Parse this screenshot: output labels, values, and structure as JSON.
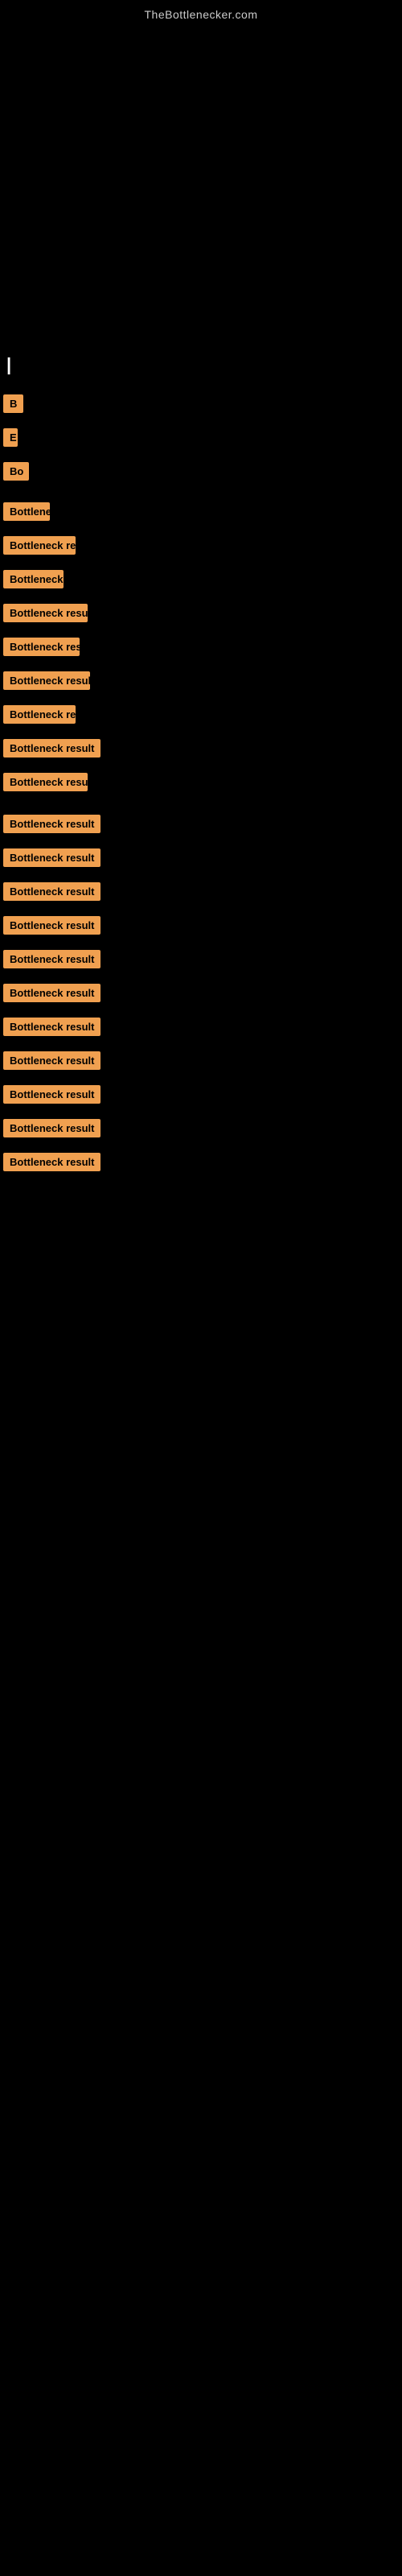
{
  "site": {
    "title": "TheBottlenecker.com"
  },
  "labels": [
    {
      "id": "lbl-pipe",
      "text": "|",
      "width_class": ""
    },
    {
      "id": "lbl-b1",
      "text": "B",
      "width_class": "w-short1"
    },
    {
      "id": "lbl-e1",
      "text": "E",
      "width_class": "w-short2"
    },
    {
      "id": "lbl-b2",
      "text": "Bo",
      "width_class": "w-short3"
    },
    {
      "id": "lbl-bottl1",
      "text": "Bottleneck result",
      "width_class": "w-med1"
    },
    {
      "id": "lbl-bottl2",
      "text": "Bottleneck result",
      "width_class": "w-med2"
    },
    {
      "id": "lbl-bottl3",
      "text": "Bottleneck result",
      "width_class": "w-med3"
    },
    {
      "id": "lbl-bottl4",
      "text": "Bottleneck result",
      "width_class": "w-med4"
    },
    {
      "id": "lbl-bottl5",
      "text": "Bottleneck result",
      "width_class": "w-med5"
    },
    {
      "id": "lbl-bottl6",
      "text": "Bottleneck result",
      "width_class": "w-med6"
    },
    {
      "id": "lbl-bottl7",
      "text": "Bottleneck result",
      "width_class": "w-med2"
    },
    {
      "id": "lbl-bottl8",
      "text": "Bottleneck result",
      "width_class": "w-full"
    },
    {
      "id": "lbl-bottl9",
      "text": "Bottleneck result",
      "width_class": "w-med4"
    },
    {
      "id": "lbl-bottl10",
      "text": "Bottleneck result",
      "width_class": "w-full2"
    },
    {
      "id": "lbl-bottl11",
      "text": "Bottleneck result",
      "width_class": "w-full2"
    },
    {
      "id": "lbl-bottl12",
      "text": "Bottleneck result",
      "width_class": "w-full2"
    },
    {
      "id": "lbl-bottl13",
      "text": "Bottleneck result",
      "width_class": "w-full2"
    },
    {
      "id": "lbl-bottl14",
      "text": "Bottleneck result",
      "width_class": "w-full2"
    },
    {
      "id": "lbl-bottl15",
      "text": "Bottleneck result",
      "width_class": "w-full2"
    },
    {
      "id": "lbl-bottl16",
      "text": "Bottleneck result",
      "width_class": "w-full2"
    },
    {
      "id": "lbl-bottl17",
      "text": "Bottleneck result",
      "width_class": "w-full2"
    },
    {
      "id": "lbl-bottl18",
      "text": "Bottleneck result",
      "width_class": "w-full2"
    },
    {
      "id": "lbl-bottl19",
      "text": "Bottleneck result",
      "width_class": "w-full2"
    },
    {
      "id": "lbl-bottl20",
      "text": "Bottleneck result",
      "width_class": "w-full2"
    }
  ]
}
